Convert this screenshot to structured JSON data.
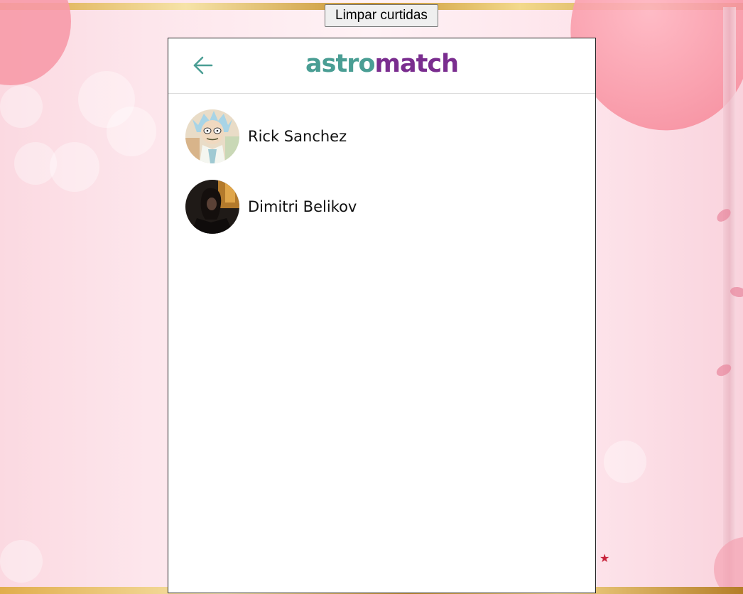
{
  "toolbar": {
    "clear_label": "Limpar curtidas"
  },
  "header": {
    "back_icon": "arrow-left-icon",
    "logo_part1": "astro",
    "logo_part2": "match",
    "logo_colors": {
      "astro": "#4a9e94",
      "match": "#7a2d8f"
    }
  },
  "matches": [
    {
      "name": "Rick Sanchez",
      "avatar": "rick-sanchez-avatar"
    },
    {
      "name": "Dimitri Belikov",
      "avatar": "dimitri-belikov-avatar"
    }
  ],
  "colors": {
    "accent": "#4a9e94",
    "brand": "#7a2d8f"
  }
}
